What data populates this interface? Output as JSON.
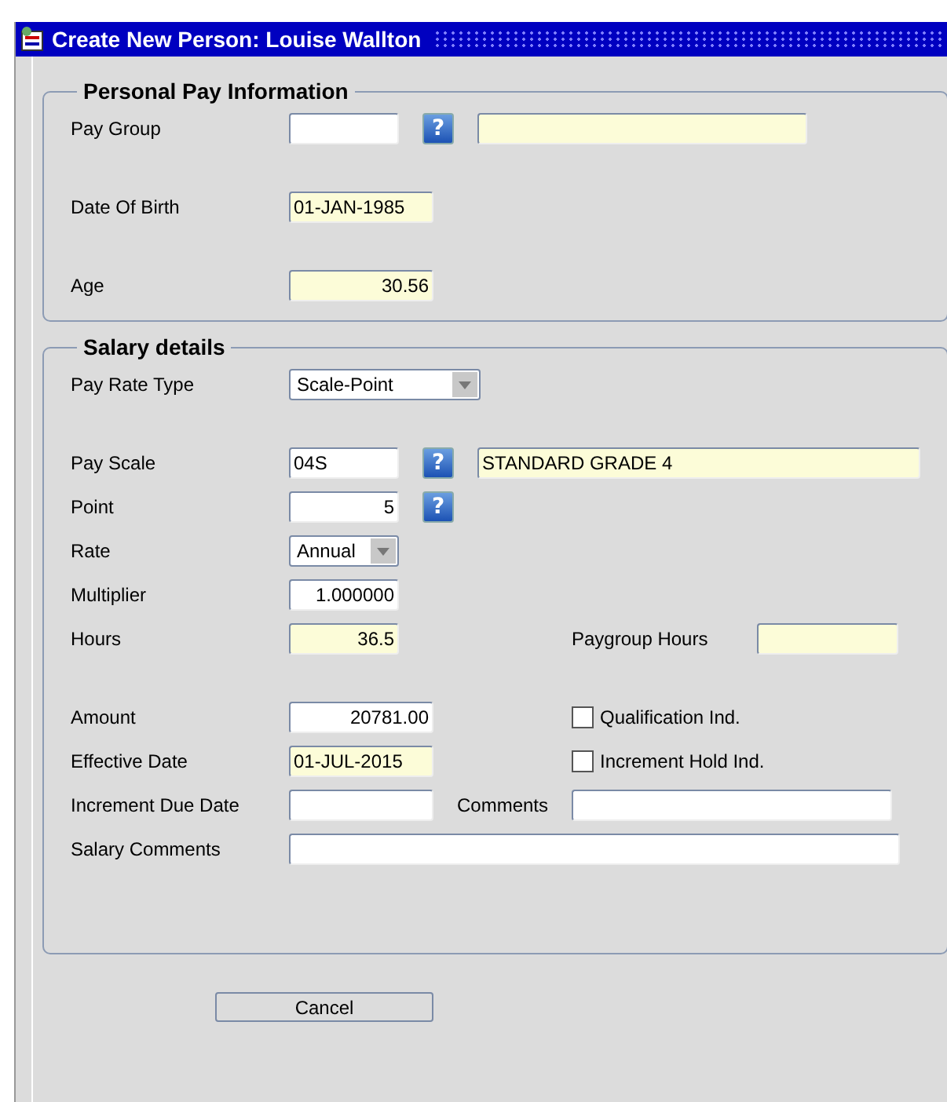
{
  "window": {
    "title": "Create New Person: Louise Wallton"
  },
  "sections": [
    {
      "title": "Personal Pay Information",
      "blocks": [
        [
          {
            "label": "Pay Group",
            "controls": [
              {
                "kind": "code",
                "readonly": false
              },
              {
                "kind": "help",
                "glyph": "?"
              },
              {
                "kind": "name",
                "readonly": true
              }
            ]
          }
        ],
        [
          {
            "label": "Date Of Birth",
            "controls": [
              {
                "kind": "date",
                "value": "01-JAN-1985",
                "readonly": true
              }
            ]
          }
        ],
        [
          {
            "label": "Age",
            "controls": [
              {
                "kind": "amount",
                "value": "30.56",
                "readonly": true
              }
            ]
          }
        ]
      ]
    },
    {
      "title": "Salary details",
      "blocks": [
        [
          {
            "label": "Pay Rate Type",
            "controls": [
              {
                "kind": "type_select",
                "value": "Scale-Point"
              }
            ]
          }
        ],
        [
          {
            "label": "Pay Scale",
            "controls": [
              {
                "kind": "code",
                "value": "04S",
                "readonly": false
              },
              {
                "kind": "help",
                "glyph": "?"
              },
              {
                "kind": "description",
                "value": "STANDARD GRADE 4",
                "readonly": true
              }
            ]
          },
          {
            "label": "Point",
            "controls": [
              {
                "kind": "number",
                "value": "5",
                "readonly": false
              },
              {
                "kind": "help",
                "glyph": "?"
              }
            ]
          },
          {
            "label": "Rate",
            "controls": [
              {
                "kind": "rate_select",
                "value": "Annual"
              }
            ]
          },
          {
            "label": "Multiplier",
            "controls": [
              {
                "kind": "number",
                "value": "1.000000",
                "readonly": false
              }
            ]
          },
          {
            "label": "Hours",
            "controls": [
              {
                "kind": "number",
                "value": "36.5",
                "readonly": true
              }
            ],
            "side": [
              {
                "kind": "label",
                "text": "Paygroup Hours"
              },
              {
                "kind": "hours",
                "readonly": true
              }
            ]
          }
        ],
        [
          {
            "label": "Amount",
            "controls": [
              {
                "kind": "amount",
                "value": "20781.00",
                "readonly": false
              }
            ],
            "side": [
              {
                "kind": "checkbox",
                "text": "Qualification Ind.",
                "checked": false
              }
            ]
          },
          {
            "label": "Effective Date",
            "controls": [
              {
                "kind": "date",
                "value": "01-JUL-2015",
                "readonly": true
              }
            ],
            "side": [
              {
                "kind": "checkbox",
                "text": "Increment Hold Ind.",
                "checked": false
              }
            ]
          },
          {
            "label": "Increment Due Date",
            "controls": [
              {
                "kind": "date",
                "readonly": false
              },
              {
                "kind": "label",
                "text": "Comments"
              },
              {
                "kind": "comments",
                "readonly": false
              }
            ]
          },
          {
            "label": "Salary Comments",
            "controls": [
              {
                "kind": "notes",
                "readonly": false
              }
            ]
          }
        ]
      ]
    }
  ],
  "buttons": [
    {
      "label": "Cancel"
    }
  ]
}
